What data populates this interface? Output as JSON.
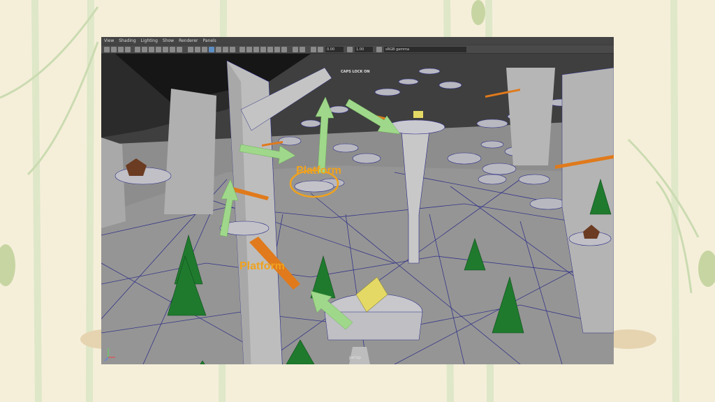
{
  "maya_viewport": {
    "menu": [
      "View",
      "Shading",
      "Lighting",
      "Show",
      "Renderer",
      "Panels"
    ],
    "toolbar": {
      "field_a": "0.00",
      "field_b": "1.00",
      "color_space": "sRGB gamma"
    },
    "camera_label": "persp",
    "hud_text": "CAPS LOCK ON"
  },
  "annotations": {
    "platform_upper": "Platform",
    "platform_lower": "Platform"
  },
  "colors": {
    "arrow": "#9fd88a",
    "highlight": "#f0a21e",
    "ground": "#8f8f8f",
    "wireframe": "#2a2a88",
    "tree": "#1f7a2e",
    "house_yellow": "#e5d966"
  }
}
